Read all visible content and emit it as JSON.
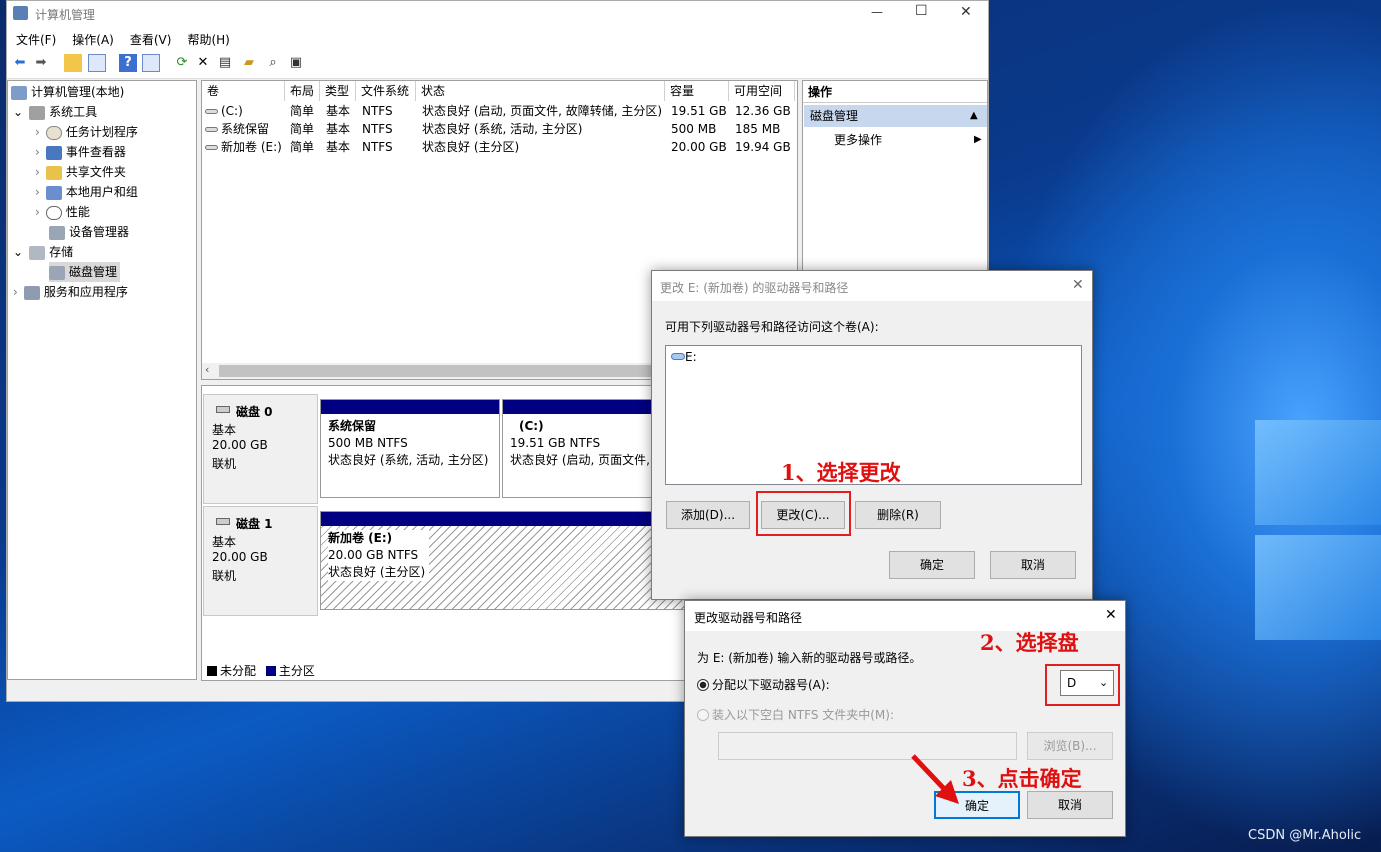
{
  "window": {
    "title": "计算机管理",
    "min": "—",
    "max": "☐",
    "close": "✕"
  },
  "menu": [
    "文件(F)",
    "操作(A)",
    "查看(V)",
    "帮助(H)"
  ],
  "tree": [
    {
      "label": "计算机管理(本地)",
      "icon": "computer-icon"
    },
    {
      "label": "系统工具",
      "icon": "tools-icon"
    },
    {
      "label": "任务计划程序",
      "icon": "clock-icon"
    },
    {
      "label": "事件查看器",
      "icon": "event-icon"
    },
    {
      "label": "共享文件夹",
      "icon": "folder-icon"
    },
    {
      "label": "本地用户和组",
      "icon": "users-icon"
    },
    {
      "label": "性能",
      "icon": "performance-icon"
    },
    {
      "label": "设备管理器",
      "icon": "device-icon"
    },
    {
      "label": "存储",
      "icon": "storage-icon"
    },
    {
      "label": "磁盘管理",
      "icon": "disk-icon"
    },
    {
      "label": "服务和应用程序",
      "icon": "services-icon"
    }
  ],
  "volumes": {
    "headers": [
      "卷",
      "布局",
      "类型",
      "文件系统",
      "状态",
      "容量",
      "可用空间"
    ],
    "rows": [
      [
        "(C:)",
        "简单",
        "基本",
        "NTFS",
        "状态良好 (启动, 页面文件, 故障转储, 主分区)",
        "19.51 GB",
        "12.36 GB"
      ],
      [
        "系统保留",
        "简单",
        "基本",
        "NTFS",
        "状态良好 (系统, 活动, 主分区)",
        "500 MB",
        "185 MB"
      ],
      [
        "新加卷 (E:)",
        "简单",
        "基本",
        "NTFS",
        "状态良好 (主分区)",
        "20.00 GB",
        "19.94 GB"
      ]
    ]
  },
  "disks": [
    {
      "name": "磁盘 0",
      "type": "基本",
      "size": "20.00 GB",
      "state": "联机",
      "parts": [
        {
          "name": "系统保留",
          "size": "500 MB NTFS",
          "status": "状态良好 (系统, 活动, 主分区)"
        },
        {
          "name": "(C:)",
          "size": "19.51 GB NTFS",
          "status": "状态良好 (启动, 页面文件, 故"
        }
      ]
    },
    {
      "name": "磁盘 1",
      "type": "基本",
      "size": "20.00 GB",
      "state": "联机",
      "parts": [
        {
          "name": "新加卷  (E:)",
          "size": "20.00 GB NTFS",
          "status": "状态良好 (主分区)"
        }
      ]
    }
  ],
  "legend": {
    "unallocated": "未分配",
    "primary": "主分区"
  },
  "actions": {
    "header": "操作",
    "section": "磁盘管理",
    "more": "更多操作"
  },
  "dialog1": {
    "title": "更改 E: (新加卷) 的驱动器号和路径",
    "prompt": "可用下列驱动器号和路径访问这个卷(A):",
    "item": "E:",
    "add": "添加(D)...",
    "change": "更改(C)...",
    "remove": "删除(R)",
    "ok": "确定",
    "cancel": "取消"
  },
  "dialog2": {
    "title": "更改驱动器号和路径",
    "prompt": "为 E: (新加卷) 输入新的驱动器号或路径。",
    "opt1": "分配以下驱动器号(A):",
    "letter": "D",
    "opt2": "装入以下空白 NTFS 文件夹中(M):",
    "browse": "浏览(B)...",
    "ok": "确定",
    "cancel": "取消"
  },
  "annotations": {
    "step1": "1、选择更改",
    "step2": "2、选择盘",
    "step3": "3、点击确定"
  },
  "watermark": "CSDN @Mr.Aholic"
}
